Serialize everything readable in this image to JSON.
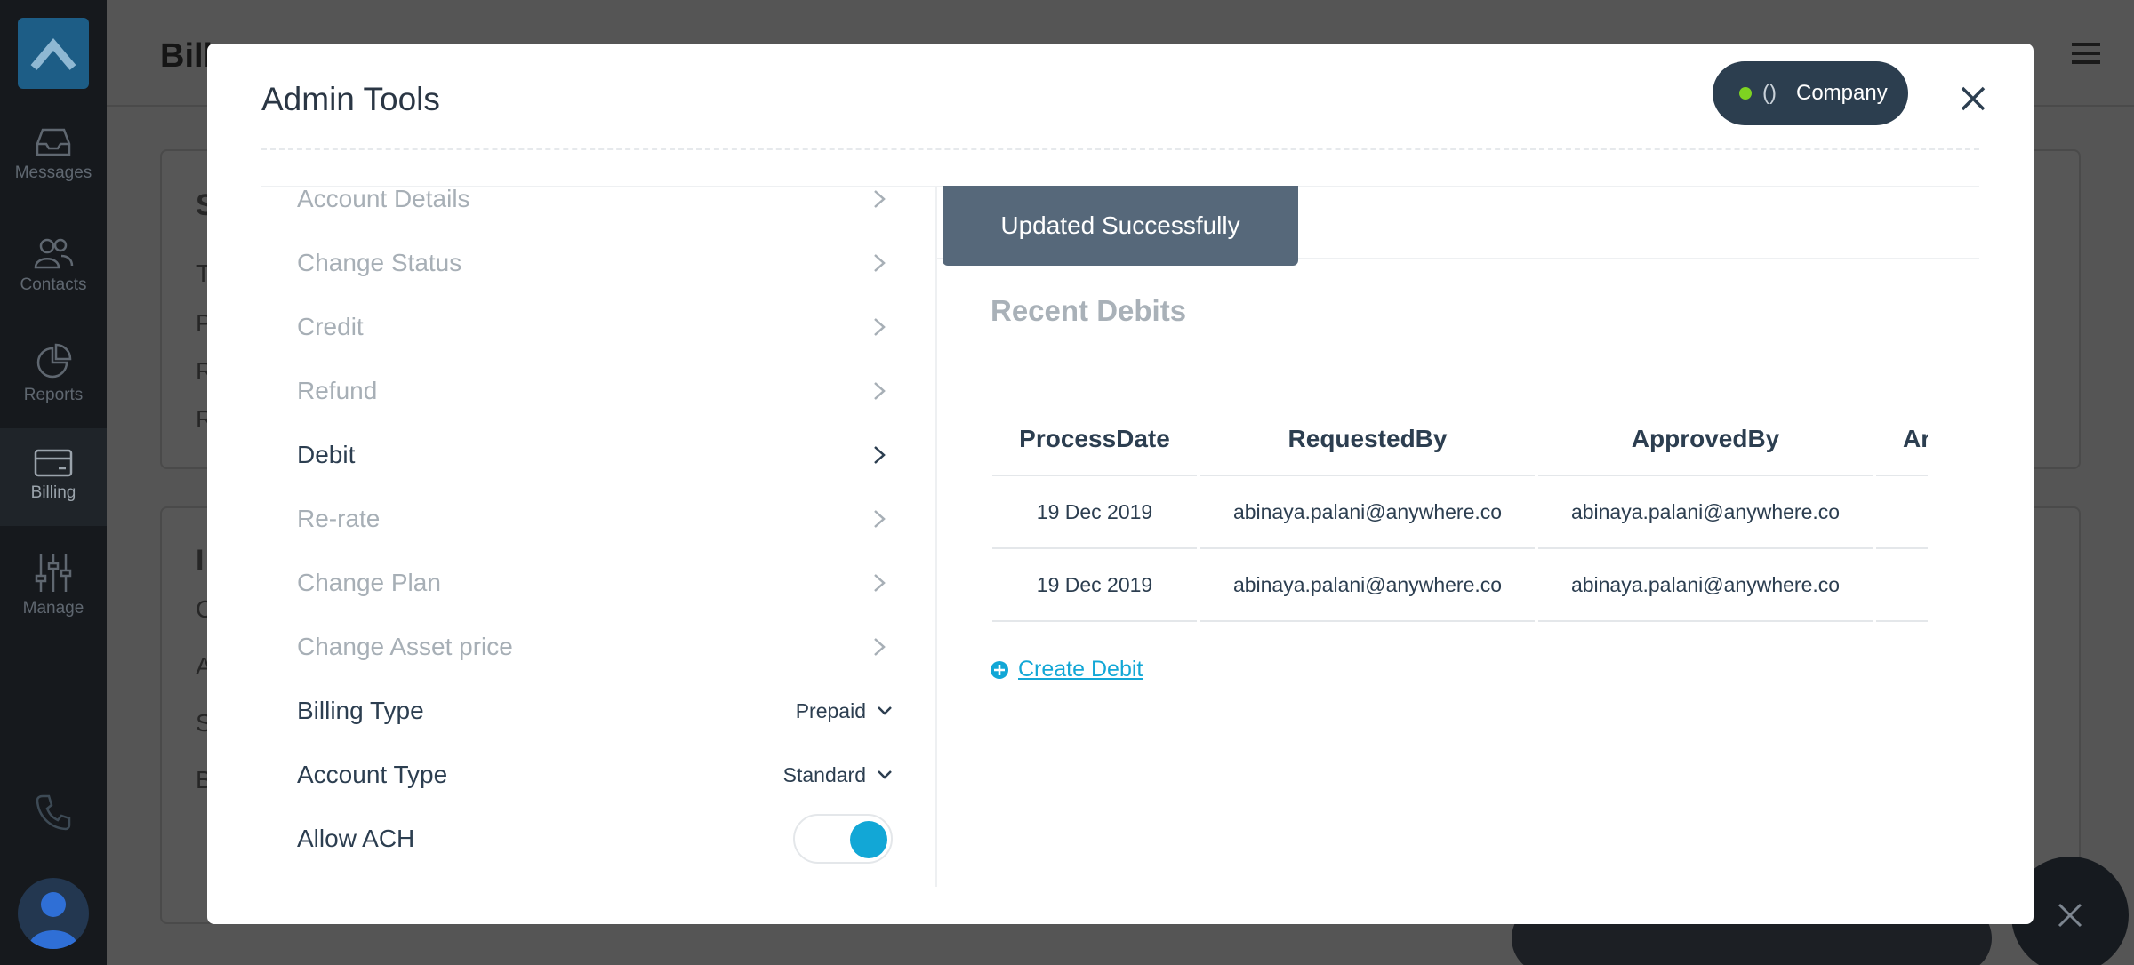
{
  "background": {
    "page_title": "Bill",
    "nav": [
      {
        "label": "Messages",
        "icon": "inbox-icon"
      },
      {
        "label": "Contacts",
        "icon": "contacts-icon"
      },
      {
        "label": "Reports",
        "icon": "pie-chart-icon"
      },
      {
        "label": "Billing",
        "icon": "credit-card-icon"
      },
      {
        "label": "Manage",
        "icon": "sliders-icon"
      }
    ],
    "card_letters_top": [
      "S",
      "T",
      "P",
      "R",
      "R"
    ],
    "card_letters_bottom": [
      "I",
      "C",
      "A",
      "S",
      "B"
    ]
  },
  "modal": {
    "title": "Admin Tools",
    "company": {
      "paren": "()",
      "label": "Company",
      "status_color": "#7ed321"
    },
    "menu": [
      {
        "label": "Account Details"
      },
      {
        "label": "Change Status"
      },
      {
        "label": "Credit"
      },
      {
        "label": "Refund"
      },
      {
        "label": "Debit"
      },
      {
        "label": "Re-rate"
      },
      {
        "label": "Change Plan"
      },
      {
        "label": "Change Asset price"
      }
    ],
    "billing_type": {
      "label": "Billing Type",
      "value": "Prepaid"
    },
    "account_type": {
      "label": "Account Type",
      "value": "Standard"
    },
    "allow_ach": {
      "label": "Allow ACH",
      "enabled": true
    },
    "toast": "Updated Successfully",
    "section_title": "Recent Debits",
    "table": {
      "headers": [
        "ProcessDate",
        "RequestedBy",
        "ApprovedBy",
        "Ar"
      ],
      "rows": [
        [
          "19 Dec 2019",
          "abinaya.palani@anywhere.co",
          "abinaya.palani@anywhere.co",
          ""
        ],
        [
          "19 Dec 2019",
          "abinaya.palani@anywhere.co",
          "abinaya.palani@anywhere.co",
          ""
        ]
      ]
    },
    "create_link": "Create Debit",
    "accent_color": "#12a7d6"
  }
}
